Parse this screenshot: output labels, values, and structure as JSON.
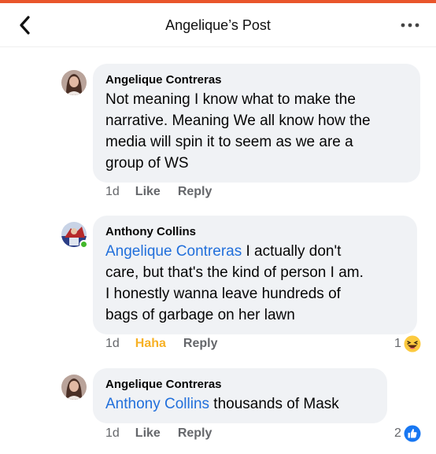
{
  "header": {
    "title": "Angelique’s Post",
    "back_icon": "chevron-left-icon",
    "more_icon": "ellipsis-icon"
  },
  "colors": {
    "accent": "#e9552b",
    "mention": "#216fdb",
    "haha": "#f7b125",
    "like": "#1877f2",
    "bubble": "#f0f2f5"
  },
  "comments": [
    {
      "author": "Angelique Contreras",
      "mention": "",
      "lines": [
        "Not meaning I know what to make the",
        "narrative. Meaning We all know how the",
        "media will spin it to seem as we are a",
        "group of WS"
      ],
      "time": "1d",
      "reaction_label": "Like",
      "reply_label": "Reply"
    },
    {
      "author": "Anthony Collins",
      "mention": "Angelique Contreras",
      "first_line_rest": " I actually don't",
      "lines": [
        "care, but that's the kind of person I am.",
        "I honestly wanna leave hundreds of",
        "bags of garbage on her lawn"
      ],
      "time": "1d",
      "reaction_label": "Haha",
      "reply_label": "Reply",
      "reaction_count": "1",
      "reaction_icon": "haha-emoji-icon"
    },
    {
      "author": "Angelique Contreras",
      "mention": "Anthony Collins",
      "first_line_rest": " thousands of Mask",
      "time": "1d",
      "reaction_label": "Like",
      "reply_label": "Reply",
      "reaction_count": "2",
      "reaction_icon": "like-thumb-icon"
    }
  ]
}
